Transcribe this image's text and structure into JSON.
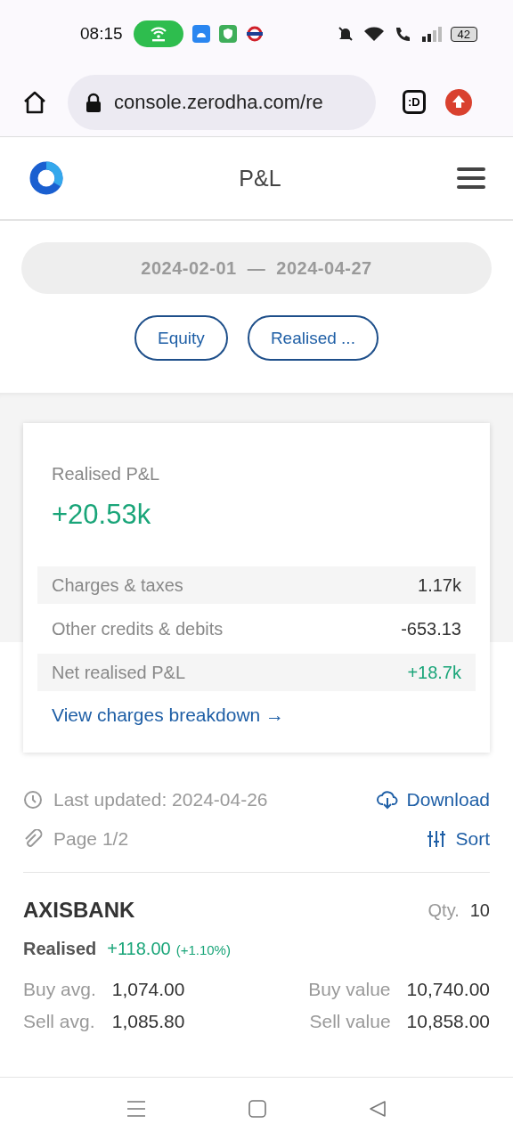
{
  "status_bar": {
    "time": "08:15",
    "battery": "42"
  },
  "browser": {
    "url": "console.zerodha.com/re",
    "tab_badge": ":D"
  },
  "header": {
    "title": "P&L"
  },
  "filters": {
    "date_from": "2024-02-01",
    "separator": "—",
    "date_to": "2024-04-27",
    "chips": [
      {
        "label": "Equity"
      },
      {
        "label": "Realised ..."
      }
    ]
  },
  "summary": {
    "label": "Realised P&L",
    "value": "+20.53k",
    "value_positive": true,
    "rows": [
      {
        "label": "Charges & taxes",
        "value": "1.17k",
        "positive": false
      },
      {
        "label": "Other credits & debits",
        "value": "-653.13",
        "positive": false
      },
      {
        "label": "Net realised P&L",
        "value": "+18.7k",
        "positive": true
      }
    ],
    "link": {
      "label": "View charges breakdown",
      "arrow": "→"
    }
  },
  "meta": {
    "last_updated": "Last updated: 2024-04-26",
    "page": "Page 1/2",
    "download": "Download",
    "sort": "Sort"
  },
  "positions": [
    {
      "symbol": "AXISBANK",
      "qty_label": "Qty.",
      "qty": "10",
      "status": "Realised",
      "pnl": "+118.00",
      "pnl_pct": "(+1.10%)",
      "positive": true,
      "stats": [
        {
          "label": "Buy avg.",
          "value": "1,074.00"
        },
        {
          "label": "Buy value",
          "value": "10,740.00"
        },
        {
          "label": "Sell avg.",
          "value": "1,085.80"
        },
        {
          "label": "Sell value",
          "value": "10,858.00"
        }
      ]
    }
  ]
}
